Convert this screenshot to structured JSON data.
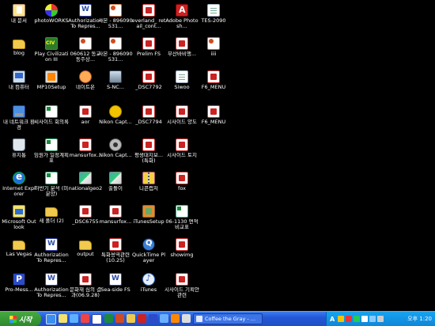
{
  "desktop_icons": [
    {
      "label": "내 문서",
      "icon": "my-documents-icon",
      "type": "mydoc"
    },
    {
      "label": "blog",
      "icon": "folder-icon",
      "type": "folder"
    },
    {
      "label": "내 컴퓨터",
      "icon": "my-computer-icon",
      "type": "mycomp"
    },
    {
      "label": "내 네트워크 환경",
      "icon": "network-places-icon",
      "type": "net"
    },
    {
      "label": "휴지통",
      "icon": "recycle-bin-icon",
      "type": "trash"
    },
    {
      "label": "Internet Explorer",
      "icon": "internet-explorer-icon",
      "type": "ie"
    },
    {
      "label": "Microsoft Outlook",
      "icon": "outlook-icon",
      "type": "outlook"
    },
    {
      "label": "Las Vegas",
      "icon": "folder-icon",
      "type": "folder"
    },
    {
      "label": "Pro-Mess...",
      "icon": "application-icon",
      "type": "promess"
    },
    {
      "label": "photoWORKS",
      "icon": "application-icon",
      "type": "pinwheel"
    },
    {
      "label": "Play Civilization III",
      "icon": "civilization-icon",
      "type": "civ"
    },
    {
      "label": "MP10Setup",
      "icon": "setup-icon",
      "type": "setup"
    },
    {
      "label": "씨사이드 회의록",
      "icon": "excel-icon",
      "type": "xls"
    },
    {
      "label": "임원가 일정계획표",
      "icon": "excel-icon",
      "type": "xls"
    },
    {
      "label": "하반기 분석 (미분양)",
      "icon": "excel-icon",
      "type": "xls"
    },
    {
      "label": "새 폴더 (2)",
      "icon": "folder-icon",
      "type": "folder"
    },
    {
      "label": "Authorization To Repres...",
      "icon": "word-icon",
      "type": "word"
    },
    {
      "label": "Authorization To Repres...",
      "icon": "word-icon",
      "type": "word"
    },
    {
      "label": "Authorization To Repres...",
      "icon": "word-icon",
      "type": "word"
    },
    {
      "label": "060612 동교동주상...",
      "icon": "powerpoint-icon",
      "type": "ppt"
    },
    {
      "label": "네이트온",
      "icon": "nateon-icon",
      "type": "kid"
    },
    {
      "label": "aor",
      "icon": "pdf-icon",
      "type": "pdf"
    },
    {
      "label": "mansurfox...",
      "icon": "pdf-icon",
      "type": "pdf"
    },
    {
      "label": "nationalgeo2",
      "icon": "image-icon",
      "type": "img"
    },
    {
      "label": "_DSC6755",
      "icon": "pdf-icon",
      "type": "pdf"
    },
    {
      "label": "output",
      "icon": "folder-icon",
      "type": "folder"
    },
    {
      "label": "문화재 심의 결과(06.9.28)",
      "icon": "pdf-icon",
      "type": "pdf"
    },
    {
      "label": "사본 - 896090531...",
      "icon": "powerpoint-icon",
      "type": "ppt"
    },
    {
      "label": "사본 - 896090531...",
      "icon": "powerpoint-icon",
      "type": "ppt"
    },
    {
      "label": "S-NC...",
      "icon": "application-icon",
      "type": "sncs"
    },
    {
      "label": "Nikon Capt...",
      "icon": "nikon-capture-icon",
      "type": "nikon"
    },
    {
      "label": "Nikon Capt...",
      "icon": "nikon-capture-icon",
      "type": "nikon2"
    },
    {
      "label": "출돌이",
      "icon": "image-icon",
      "type": "img"
    },
    {
      "label": "mansurfox...",
      "icon": "pdf-icon",
      "type": "pdf"
    },
    {
      "label": "특화용역관련 (10.25)",
      "icon": "pdf-icon",
      "type": "pdf"
    },
    {
      "label": "Sea-side FS",
      "icon": "word-icon",
      "type": "word"
    },
    {
      "label": "everland_ retail_cont...",
      "icon": "pdf-icon",
      "type": "pdf"
    },
    {
      "label": "Prelim FS",
      "icon": "pdf-icon",
      "type": "pdf"
    },
    {
      "label": "_DSC7792",
      "icon": "pdf-icon",
      "type": "pdf"
    },
    {
      "label": "_DSC7794",
      "icon": "pdf-icon",
      "type": "pdf"
    },
    {
      "label": "평생대지보... (특화)",
      "icon": "pdf-icon",
      "type": "pdf"
    },
    {
      "label": "니콘캡처",
      "icon": "zip-icon",
      "type": "zip"
    },
    {
      "label": "iTunesSetup",
      "icon": "itunes-setup-icon",
      "type": "wrench"
    },
    {
      "label": "QuickTime Player",
      "icon": "quicktime-icon",
      "type": "qt"
    },
    {
      "label": "iTunes",
      "icon": "itunes-icon",
      "type": "itunes"
    },
    {
      "label": "Adobe Photosh...",
      "icon": "adobe-icon",
      "type": "adobe"
    },
    {
      "label": "부산바비앵...",
      "icon": "pdf-icon",
      "type": "pdf"
    },
    {
      "label": "Siwoo",
      "icon": "document-icon",
      "type": "doc"
    },
    {
      "label": "시사이드 양도",
      "icon": "pdf-icon",
      "type": "pdf"
    },
    {
      "label": "시사이드 토지",
      "icon": "pdf-icon",
      "type": "pdf"
    },
    {
      "label": "fox",
      "icon": "pdf-icon",
      "type": "pdf"
    },
    {
      "label": "06-1130 면적비교표",
      "icon": "excel-icon",
      "type": "xls"
    },
    {
      "label": "showimg",
      "icon": "pdf-icon",
      "type": "pdf"
    },
    {
      "label": "시사이드 기획안 관련",
      "icon": "pdf-icon",
      "type": "pdf"
    },
    {
      "label": "TES-2090",
      "icon": "document-icon",
      "type": "doc"
    },
    {
      "label": "iiii",
      "icon": "powerpoint-icon",
      "type": "ppt"
    },
    {
      "label": "F6_MENU",
      "icon": "pdf-icon",
      "type": "pdf"
    },
    {
      "label": "F6_MENU",
      "icon": "pdf-icon",
      "type": "pdf"
    }
  ],
  "taskbar": {
    "start_label": "시작",
    "active_task": "Coffee the Gray - ...",
    "ime_indicator": "A",
    "clock": "오후 1:20"
  },
  "colors": {
    "desktop_bg": "#000000",
    "taskbar": "#2457d6",
    "start_button": "#3a9a36",
    "tray": "#0f86d9"
  }
}
